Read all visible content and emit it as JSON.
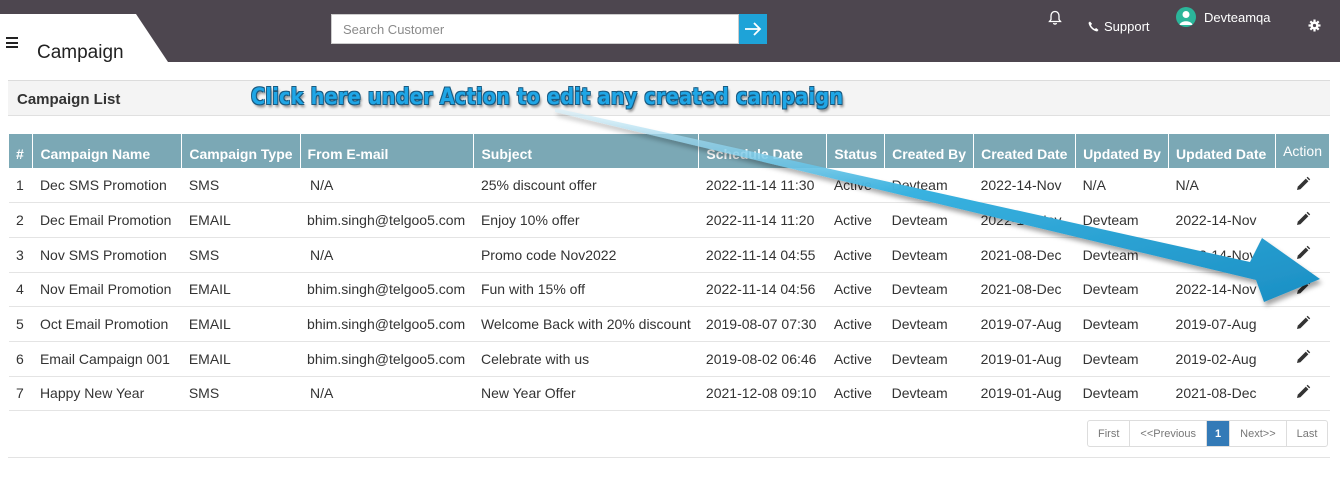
{
  "header": {
    "title": "Campaign",
    "search_placeholder": "Search Customer",
    "support_label": "Support",
    "user_name": "Devteamqa"
  },
  "panel": {
    "title": "Campaign List",
    "callout": "Click here under Action to edit any created campaign"
  },
  "table": {
    "columns": [
      "#",
      "Campaign Name",
      "Campaign Type",
      "From E-mail",
      "Subject",
      "Schedule Date",
      "Status",
      "Created By",
      "Created Date",
      "Updated By",
      "Updated Date",
      "Action"
    ],
    "rows": [
      [
        "1",
        "Dec SMS Promotion",
        "SMS",
        "N/A",
        "25% discount offer",
        "2022-11-14 11:30",
        "Active",
        "Devteam",
        "2022-14-Nov",
        "N/A",
        "N/A"
      ],
      [
        "2",
        "Dec Email Promotion",
        "EMAIL",
        "bhim.singh@telgoo5.com",
        "Enjoy 10% offer",
        "2022-11-14 11:20",
        "Active",
        "Devteam",
        "2022-14-Nov",
        "Devteam",
        "2022-14-Nov"
      ],
      [
        "3",
        "Nov SMS Promotion",
        "SMS",
        "N/A",
        "Promo code Nov2022",
        "2022-11-14 04:55",
        "Active",
        "Devteam",
        "2021-08-Dec",
        "Devteam",
        "2022-14-Nov"
      ],
      [
        "4",
        "Nov Email Promotion",
        "EMAIL",
        "bhim.singh@telgoo5.com",
        "Fun with 15% off",
        "2022-11-14 04:56",
        "Active",
        "Devteam",
        "2021-08-Dec",
        "Devteam",
        "2022-14-Nov"
      ],
      [
        "5",
        "Oct Email Promotion",
        "EMAIL",
        "bhim.singh@telgoo5.com",
        "Welcome Back with 20% discount",
        "2019-08-07 07:30",
        "Active",
        "Devteam",
        "2019-07-Aug",
        "Devteam",
        "2019-07-Aug"
      ],
      [
        "6",
        " Email Campaign 001",
        "EMAIL",
        "bhim.singh@telgoo5.com",
        "Celebrate with us",
        "2019-08-02 06:46",
        "Active",
        "Devteam",
        "2019-01-Aug",
        "Devteam",
        "2019-02-Aug"
      ],
      [
        "7",
        "Happy New Year",
        "SMS",
        "N/A",
        "New Year Offer",
        "2021-12-08 09:10",
        "Active",
        "Devteam",
        "2019-01-Aug",
        "Devteam",
        "2021-08-Dec"
      ]
    ]
  },
  "pagination": {
    "first": "First",
    "previous": "<<Previous",
    "current": "1",
    "next": "Next>>",
    "last": "Last"
  },
  "colors": {
    "topbar": "#4d464f",
    "accent": "#1ea3d8",
    "table_header": "#7ba8b5",
    "callout": "#1fa6e6"
  }
}
